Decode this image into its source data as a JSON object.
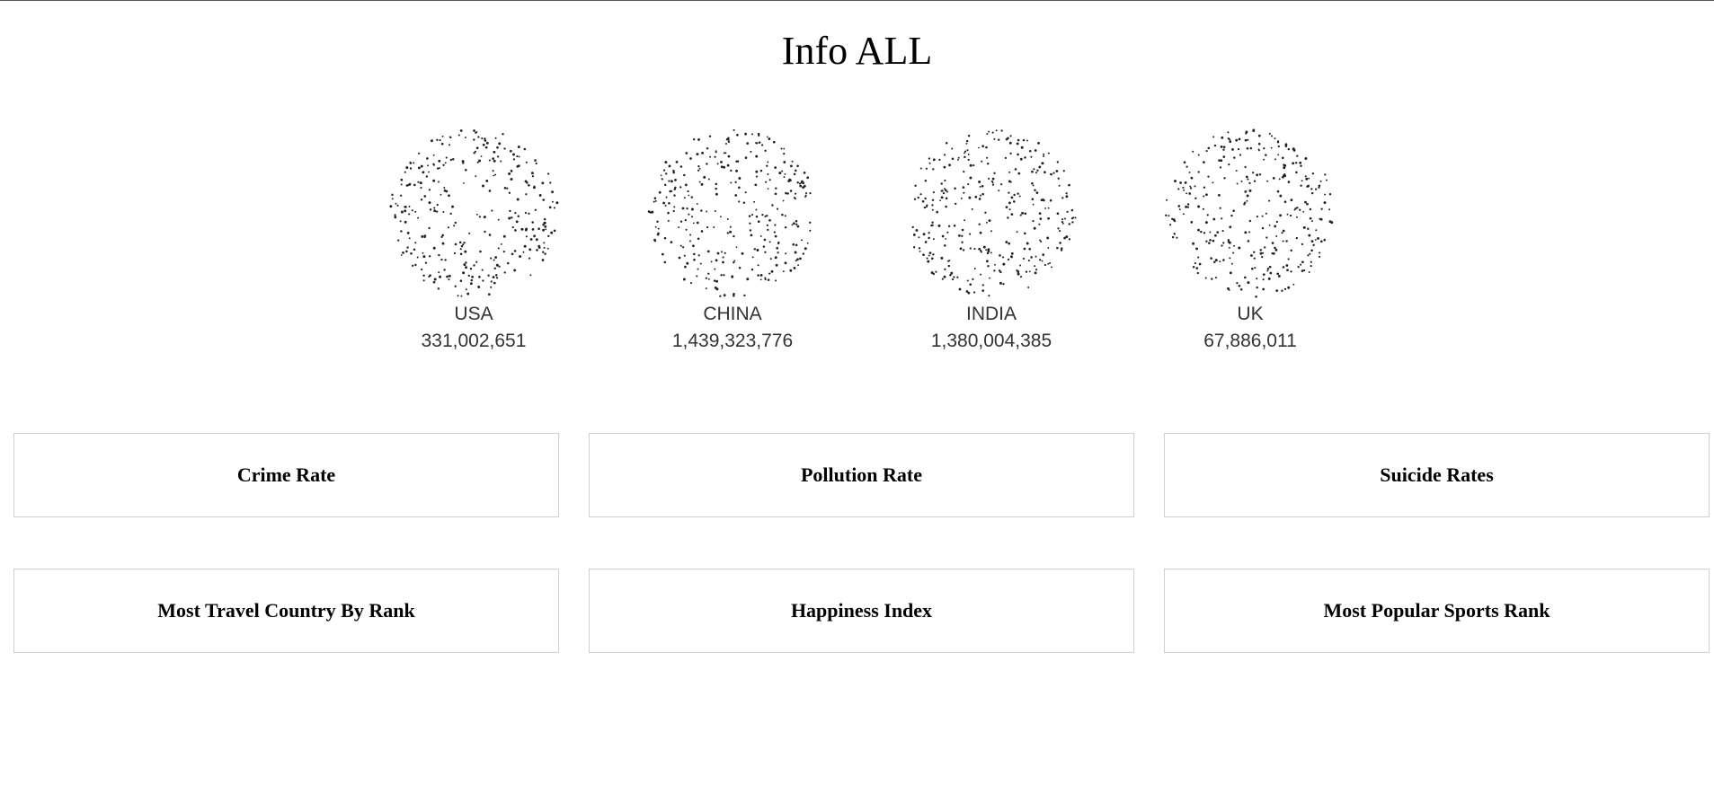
{
  "page": {
    "title": "Info ALL"
  },
  "countries": [
    {
      "name": "USA",
      "population": "331,002,651",
      "seed": 11
    },
    {
      "name": "CHINA",
      "population": "1,439,323,776",
      "seed": 29
    },
    {
      "name": "INDIA",
      "population": "1,380,004,385",
      "seed": 47
    },
    {
      "name": "UK",
      "population": "67,886,011",
      "seed": 83
    }
  ],
  "cards": [
    {
      "label": "Crime Rate"
    },
    {
      "label": "Pollution Rate"
    },
    {
      "label": "Suicide Rates"
    },
    {
      "label": "Most Travel Country By Rank"
    },
    {
      "label": "Happiness Index"
    },
    {
      "label": "Most Popular Sports Rank"
    }
  ],
  "colors": {
    "dots": "#222222",
    "card_border": "#d0d0d0",
    "text": "#333333"
  }
}
